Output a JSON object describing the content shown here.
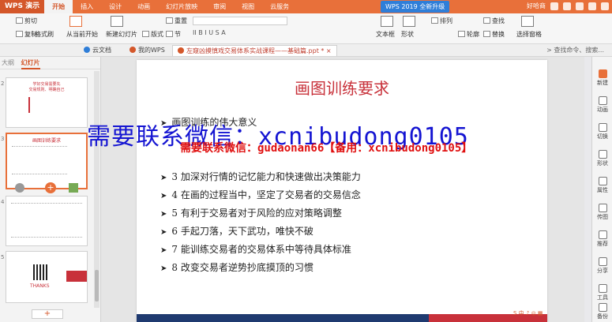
{
  "menubar": {
    "app": "WPS 演示",
    "items": [
      "开始",
      "插入",
      "设计",
      "动画",
      "幻灯片放映",
      "审阅",
      "视图",
      "云服务"
    ],
    "active_index": 0,
    "upgrade_label": "WPS 2019 全新升级",
    "user": "好哈商"
  },
  "ribbon": {
    "cut": "剪切",
    "copy": "复制",
    "format_painter": "格式刷",
    "from_current": "从当前开始",
    "new_slide": "新建幻灯片",
    "layout": "版式",
    "section": "节",
    "reset": "重置",
    "textbox": "文本框",
    "shape": "形状",
    "arrange": "排列",
    "outline": "轮廓",
    "find": "查找",
    "replace": "替换",
    "select_pane": "选择窗格",
    "font_label": "ⅠⅠ"
  },
  "tabs": {
    "items": [
      {
        "label": "云文档",
        "color": "#2f7ed8"
      },
      {
        "label": "我的WPS",
        "color": "#d4572a"
      },
      {
        "label": "左窥凶摸慎戏交易体系实战课程——基础篇.ppt *",
        "color": "#d4572a"
      }
    ],
    "active_index": 2,
    "search_hint": "查找命令、搜索..."
  },
  "left_panel": {
    "tab_outline": "大纲",
    "tab_slides": "幻灯片",
    "slide_numbers": [
      "2",
      "3",
      "4",
      "5"
    ],
    "thumb1_lines": [
      "学好交易需要先",
      "交易规则、明确自己"
    ],
    "thumb2_title": "画图训练要求",
    "thumb4_text": "THANKS",
    "add_label": "+"
  },
  "slide": {
    "title": "画图训练要求",
    "bullets": [
      "画图训练的伟大意义",
      "1 ...",
      "2 ...",
      "3 加深对行情的记忆能力和快速做出决策能力",
      "4 在画的过程当中，坚定了交易者的交易信念",
      "5 有利于交易者对于风险的应对策略调整",
      "6 手起刀落，天下武功，唯快不破",
      "7 能训练交易者的交易体系中等待具体标准",
      "8 改变交易者逆势抄底摸顶的习惯"
    ]
  },
  "watermarks": {
    "blue": "需要联系微信：xcnibudong0105",
    "red": "需要联系微信：gudaonan66【备用：xcnibudong0105】"
  },
  "right_panel": [
    "新建",
    "动画",
    "切换",
    "形状",
    "属性",
    "传图",
    "推荐",
    "分享",
    "工具",
    "备份"
  ]
}
